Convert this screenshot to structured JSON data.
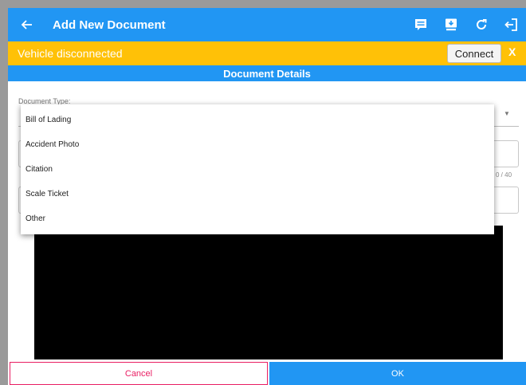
{
  "app_bar": {
    "title": "Add New Document",
    "icons": [
      "back-arrow-icon",
      "notes-icon",
      "device-sync-icon",
      "refresh-icon",
      "logout-icon"
    ]
  },
  "connection_banner": {
    "message": "Vehicle disconnected",
    "connect_label": "Connect",
    "close_label": "X"
  },
  "section": {
    "title": "Document Details"
  },
  "form": {
    "document_type_label": "Document Type:",
    "notes_counter": "0 / 40"
  },
  "dropdown": {
    "options": [
      "Bill of Lading",
      "Accident Photo",
      "Citation",
      "Scale Ticket",
      "Other"
    ]
  },
  "footer": {
    "cancel_label": "Cancel",
    "ok_label": "OK"
  },
  "colors": {
    "primary": "#2196f3",
    "warning": "#ffc107",
    "cancel": "#e91e63"
  }
}
